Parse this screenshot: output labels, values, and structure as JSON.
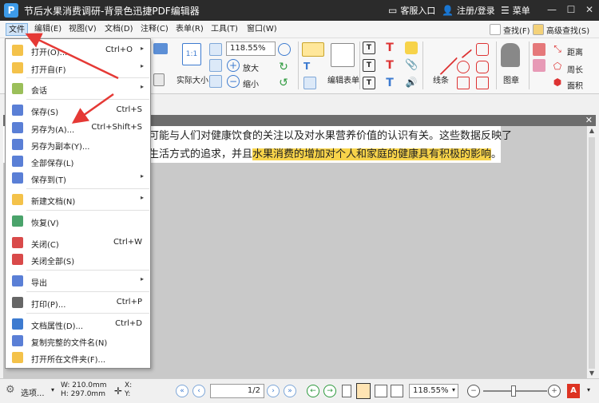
{
  "titlebar": {
    "title": "节后水果消费调研-背景色迅捷PDF编辑器",
    "logo": "P",
    "service": "客服入口",
    "login": "注册/登录",
    "menu": "菜单"
  },
  "menubar": {
    "items": [
      "文件",
      "编辑(E)",
      "视图(V)",
      "文档(D)",
      "注释(C)",
      "表单(R)",
      "工具(T)",
      "窗口(W)"
    ],
    "search": "查找(F)",
    "advanced_search": "高级查找(S)"
  },
  "ribbon": {
    "zoom_value": "118.55%",
    "actual_size": "实际大小",
    "zoom_in": "放大",
    "zoom_out": "缩小",
    "edit_form": "编辑表单",
    "line": "线条",
    "stamp": "图章",
    "distance": "距离",
    "perimeter": "周长",
    "area": "面积"
  },
  "document": {
    "line1_prefix": "可能与人们对健康饮食的关注以及对水果营养价值的认识有关。这些数据反映了",
    "line2_prefix": "生活方式的追求，并且",
    "line2_highlight": "水果消费的增加对个人和家庭的健康具有积极的影响",
    "line2_suffix": "。",
    "highlight_color": "#f7d34a"
  },
  "file_menu": {
    "items": [
      {
        "label": "打开(O)...",
        "shortcut": "Ctrl+O",
        "arrow": "▸"
      },
      {
        "label": "打开自(F)",
        "shortcut": "",
        "arrow": "▸"
      },
      {
        "label": "会话",
        "shortcut": "",
        "arrow": "▸"
      },
      {
        "label": "保存(S)",
        "shortcut": "Ctrl+S",
        "arrow": ""
      },
      {
        "label": "另存为(A)...",
        "shortcut": "Ctrl+Shift+S",
        "arrow": ""
      },
      {
        "label": "另存为副本(Y)...",
        "shortcut": "",
        "arrow": ""
      },
      {
        "label": "全部保存(L)",
        "shortcut": "",
        "arrow": ""
      },
      {
        "label": "保存到(T)",
        "shortcut": "",
        "arrow": "▸"
      },
      {
        "label": "新建文档(N)",
        "shortcut": "",
        "arrow": "▸"
      },
      {
        "label": "恢复(V)",
        "shortcut": "",
        "arrow": ""
      },
      {
        "label": "关闭(C)",
        "shortcut": "Ctrl+W",
        "arrow": ""
      },
      {
        "label": "关闭全部(S)",
        "shortcut": "",
        "arrow": ""
      },
      {
        "label": "导出",
        "shortcut": "",
        "arrow": "▸"
      },
      {
        "label": "打印(P)...",
        "shortcut": "Ctrl+P",
        "arrow": ""
      },
      {
        "label": "文档属性(D)...",
        "shortcut": "Ctrl+D",
        "arrow": ""
      },
      {
        "label": "复制完整的文件名(N)",
        "shortcut": "",
        "arrow": ""
      },
      {
        "label": "打开所在文件夹(F)...",
        "shortcut": "",
        "arrow": ""
      }
    ]
  },
  "statusbar": {
    "options": "选项...",
    "width": "W: 210.0mm",
    "height": "H: 297.0mm",
    "x_label": "X:",
    "y_label": "Y:",
    "page": "1",
    "page_total": "/2",
    "zoom": "118.55%"
  },
  "colors": {
    "titlebar": "#2b2b2b",
    "accent": "#3d9be9",
    "annotation_arrow": "#e53935"
  }
}
